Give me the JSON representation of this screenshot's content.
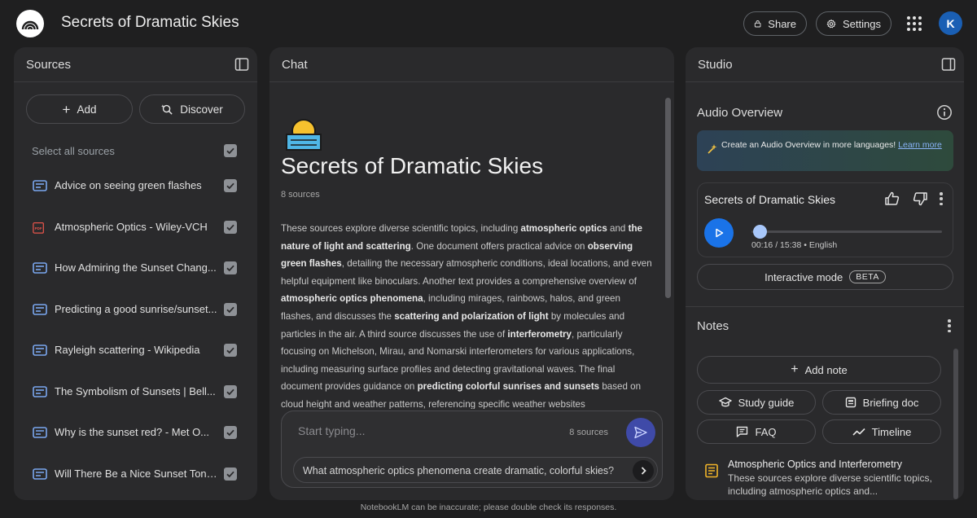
{
  "app": {
    "title": "Secrets of Dramatic Skies",
    "share_label": "Share",
    "settings_label": "Settings",
    "avatar_initial": "K"
  },
  "sources": {
    "header": "Sources",
    "add_label": "Add",
    "discover_label": "Discover",
    "select_all_label": "Select all sources",
    "items": [
      {
        "label": "Advice on seeing green flashes",
        "type": "doc-icon",
        "checked": true
      },
      {
        "label": "Atmospheric Optics - Wiley-VCH",
        "type": "pdf-icon",
        "checked": true
      },
      {
        "label": "How Admiring the Sunset Chang...",
        "type": "doc-icon",
        "checked": true
      },
      {
        "label": "Predicting a good sunrise/sunset...",
        "type": "doc-icon",
        "checked": true
      },
      {
        "label": "Rayleigh scattering - Wikipedia",
        "type": "doc-icon",
        "checked": true
      },
      {
        "label": "The Symbolism of Sunsets | Bell...",
        "type": "doc-icon",
        "checked": true
      },
      {
        "label": "Why is the sunset red? - Met O...",
        "type": "doc-icon",
        "checked": true
      },
      {
        "label": "Will There Be a Nice Sunset Toni...",
        "type": "doc-icon",
        "checked": true
      }
    ]
  },
  "chat": {
    "header": "Chat",
    "notebook_title": "Secrets of Dramatic Skies",
    "source_count": "8 sources",
    "summary": [
      {
        "t": "These sources explore diverse scientific topics, including ",
        "b": false
      },
      {
        "t": "atmospheric optics",
        "b": true
      },
      {
        "t": " and ",
        "b": false
      },
      {
        "t": "the nature of light and scattering",
        "b": true
      },
      {
        "t": ". One document offers practical advice on ",
        "b": false
      },
      {
        "t": "observing green flashes",
        "b": true
      },
      {
        "t": ", detailing the necessary atmospheric conditions, ideal locations, and even helpful equipment like binoculars. Another text provides a comprehensive overview of ",
        "b": false
      },
      {
        "t": "atmospheric optics phenomena",
        "b": true
      },
      {
        "t": ", including mirages, rainbows, halos, and green flashes, and discusses the ",
        "b": false
      },
      {
        "t": "scattering and polarization of light",
        "b": true
      },
      {
        "t": " by molecules and particles in the air. A third source discusses the use of ",
        "b": false
      },
      {
        "t": "interferometry",
        "b": true
      },
      {
        "t": ", particularly focusing on Michelson, Mirau, and Nomarski interferometers for various applications, including measuring surface profiles and detecting gravitational waves. The final document provides guidance on ",
        "b": false
      },
      {
        "t": "predicting colorful sunrises and sunsets",
        "b": true
      },
      {
        "t": " based on cloud height and weather patterns, referencing specific weather websites",
        "b": false
      }
    ],
    "input_placeholder": "Start typing...",
    "input_source_count": "8 sources",
    "suggestion": "What atmospheric optics phenomena create dramatic, colorful skies?"
  },
  "studio": {
    "header": "Studio",
    "audio_overview_title": "Audio Overview",
    "promo_text": "Create an Audio Overview in more languages!",
    "promo_link": "Learn more",
    "audio_title": "Secrets of Dramatic Skies",
    "audio_time": "00:16 / 15:38 • English",
    "audio_progress": 0.017,
    "interactive_label": "Interactive mode",
    "beta_label": "BETA",
    "notes_title": "Notes",
    "add_note_label": "Add note",
    "study_guide_label": "Study guide",
    "briefing_doc_label": "Briefing doc",
    "faq_label": "FAQ",
    "timeline_label": "Timeline",
    "note": {
      "title": "Atmospheric Optics and Interferometry",
      "body": "These sources explore diverse scientific topics, including atmospheric optics and..."
    }
  },
  "footer": "NotebookLM can be inaccurate; please double check its responses."
}
